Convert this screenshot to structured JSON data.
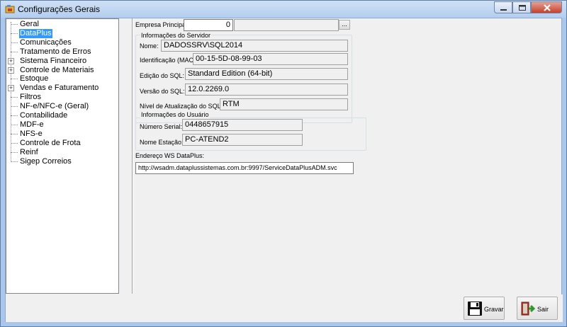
{
  "window": {
    "title": "Configurações Gerais"
  },
  "tree": {
    "items": [
      {
        "label": "Geral",
        "expandable": false,
        "selected": false
      },
      {
        "label": "DataPlus",
        "expandable": false,
        "selected": true
      },
      {
        "label": "Comunicações",
        "expandable": false,
        "selected": false
      },
      {
        "label": "Tratamento de Erros",
        "expandable": false,
        "selected": false
      },
      {
        "label": "Sistema Financeiro",
        "expandable": true,
        "selected": false
      },
      {
        "label": "Controle de Materiais",
        "expandable": true,
        "selected": false
      },
      {
        "label": "Estoque",
        "expandable": false,
        "selected": false
      },
      {
        "label": "Vendas e Faturamento",
        "expandable": true,
        "selected": false
      },
      {
        "label": "Filtros",
        "expandable": false,
        "selected": false
      },
      {
        "label": "NF-e/NFC-e (Geral)",
        "expandable": false,
        "selected": false
      },
      {
        "label": "Contabilidade",
        "expandable": false,
        "selected": false
      },
      {
        "label": "MDF-e",
        "expandable": false,
        "selected": false
      },
      {
        "label": "NFS-e",
        "expandable": false,
        "selected": false
      },
      {
        "label": "Controle de Frota",
        "expandable": false,
        "selected": false
      },
      {
        "label": "Reinf",
        "expandable": false,
        "selected": false
      },
      {
        "label": "Sigep Correios",
        "expandable": false,
        "selected": false
      }
    ]
  },
  "empresa": {
    "label": "Empresa Principal:",
    "value": "0",
    "button": "..."
  },
  "servidor": {
    "title": "Informações do Servidor",
    "nome_label": "Nome:",
    "nome": "DADOSSRV\\SQL2014",
    "mac_label": "Identificação (MAC):",
    "mac": "00-15-5D-08-99-03",
    "edicao_label": "Edição do SQL:",
    "edicao": "Standard Edition (64-bit)",
    "versao_label": "Versão do SQL:",
    "versao": "12.0.2269.0",
    "nivel_label": "Nível de Atualização do SQL:",
    "nivel": "RTM"
  },
  "usuario": {
    "title": "Informações do Usuário",
    "serial_label": "Número Serial:",
    "serial": "0448657915",
    "estacao_label": "Nome Estação:",
    "estacao": "PC-ATEND2"
  },
  "ws": {
    "label": "Endereço WS DataPlus:",
    "value": "http://wsadm.dataplussistemas.com.br:9997/ServiceDataPlusADM.svc"
  },
  "buttons": {
    "gravar": "Gravar",
    "sair": "Sair"
  },
  "colors": {
    "selection": "#3399ff",
    "title_bar": "#b4cdee"
  }
}
